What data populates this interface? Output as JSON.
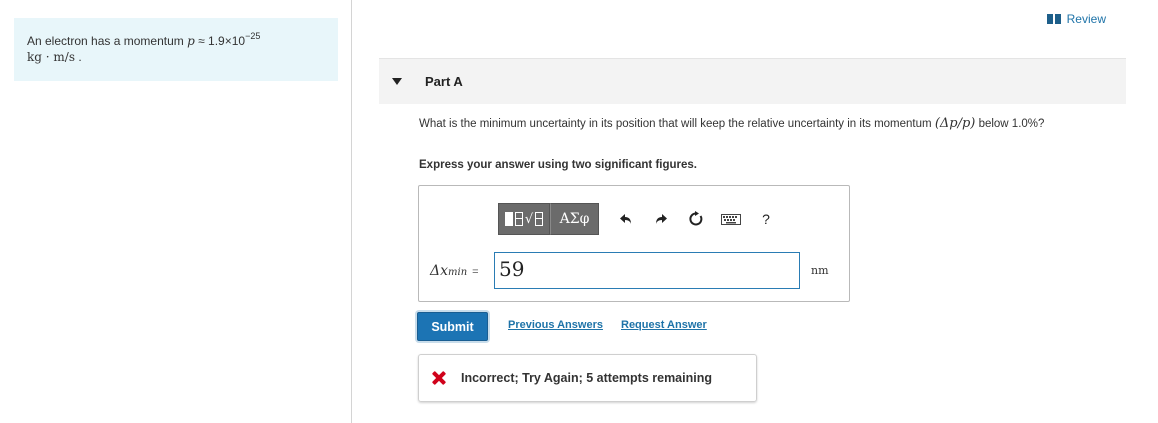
{
  "problem": {
    "text_before": "An electron has a momentum ",
    "symbol_p": "p",
    "approx": " ≈ ",
    "mantissa": "1.9×10",
    "exponent": "−25",
    "units": "kg · m/s",
    "text_after": " ."
  },
  "review": {
    "label": "Review"
  },
  "part": {
    "title": "Part A"
  },
  "question": {
    "text_before": "What is the minimum uncertainty in its position that will keep the relative uncertainty in its momentum ",
    "math": "(Δp/p)",
    "text_after": " below 1.0%?"
  },
  "instruction": "Express your answer using two significant figures.",
  "toolbar": {
    "templates_icon": "fraction-radical-icon",
    "symbols_label": "ΑΣφ",
    "undo_icon": "undo-icon",
    "redo_icon": "redo-icon",
    "reset_icon": "reset-icon",
    "keyboard_icon": "keyboard-icon",
    "help_label": "?"
  },
  "answer": {
    "var_symbol": "Δx",
    "var_sub": "min",
    "equals": "=",
    "value": "59",
    "unit": "nm"
  },
  "actions": {
    "submit_label": "Submit",
    "previous_answers": "Previous Answers",
    "request_answer": "Request Answer"
  },
  "feedback": {
    "message": "Incorrect; Try Again; 5 attempts remaining",
    "icon": "x-icon"
  },
  "colors": {
    "accent": "#1c74b4",
    "link": "#1e73a8",
    "problem_bg": "#e8f6fa",
    "error": "#d0021b"
  }
}
